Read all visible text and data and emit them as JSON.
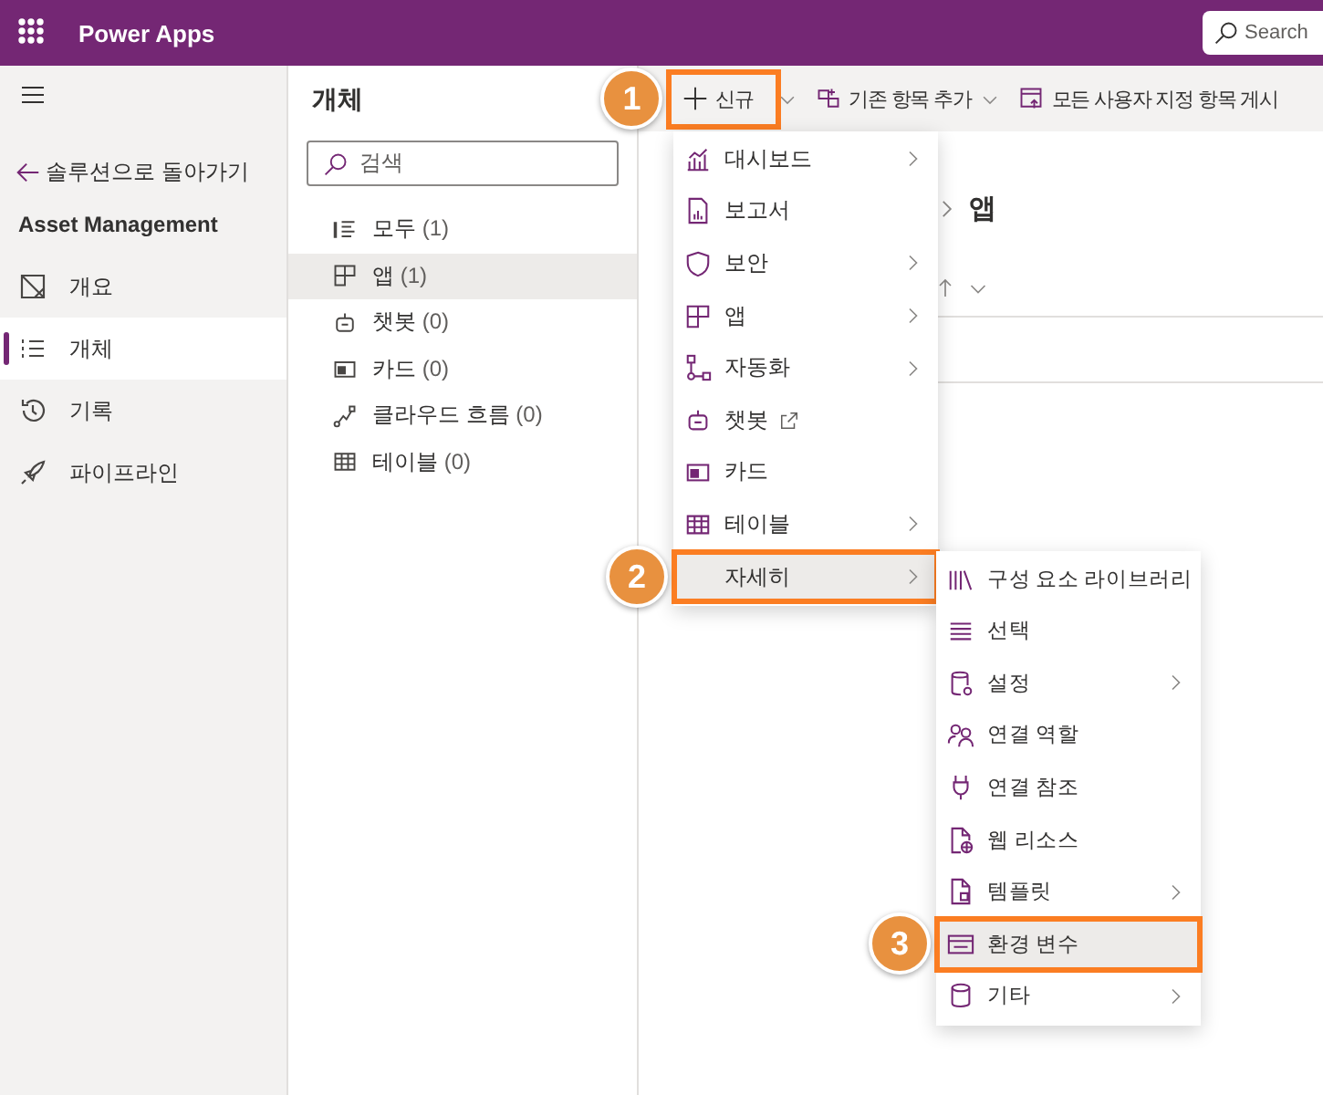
{
  "top_bar": {
    "app_title": "Power Apps",
    "search_placeholder": "Search"
  },
  "nav": {
    "back_link": "솔루션으로 돌아가기",
    "solution_title": "Asset Management",
    "items": [
      {
        "label": "개요",
        "selected": false
      },
      {
        "label": "개체",
        "selected": true
      },
      {
        "label": "기록",
        "selected": false
      },
      {
        "label": "파이프라인",
        "selected": false
      }
    ]
  },
  "objects_panel": {
    "title": "개체",
    "search_placeholder": "검색",
    "items": [
      {
        "label": "모두",
        "count": "(1)",
        "selected": false
      },
      {
        "label": "앱",
        "count": "(1)",
        "selected": true
      },
      {
        "label": "챗봇",
        "count": "(0)",
        "selected": false
      },
      {
        "label": "카드",
        "count": "(0)",
        "selected": false
      },
      {
        "label": "클라우드 흐름",
        "count": "(0)",
        "selected": false
      },
      {
        "label": "테이블",
        "count": "(0)",
        "selected": false
      }
    ]
  },
  "command_bar": {
    "items": [
      {
        "label": "신규",
        "dropdown": true,
        "callout": "1"
      },
      {
        "label": "기존 항목 추가",
        "dropdown": true
      },
      {
        "label": "모든 사용자 지정 항목 게시",
        "dropdown": false
      }
    ]
  },
  "breadcrumb": {
    "current": "앱"
  },
  "new_menu": {
    "items": [
      {
        "label": "대시보드",
        "submenu": true,
        "external": false,
        "selected": false
      },
      {
        "label": "보고서",
        "submenu": false,
        "external": false,
        "selected": false
      },
      {
        "label": "보안",
        "submenu": true,
        "external": false,
        "selected": false
      },
      {
        "label": "앱",
        "submenu": true,
        "external": false,
        "selected": false
      },
      {
        "label": "자동화",
        "submenu": true,
        "external": false,
        "selected": false
      },
      {
        "label": "챗봇",
        "submenu": false,
        "external": true,
        "selected": false
      },
      {
        "label": "카드",
        "submenu": false,
        "external": false,
        "selected": false
      },
      {
        "label": "테이블",
        "submenu": true,
        "external": false,
        "selected": false
      },
      {
        "label": "자세히",
        "submenu": true,
        "external": false,
        "selected": true,
        "callout": "2",
        "children": [
          {
            "label": "구성 요소 라이브러리",
            "submenu": false,
            "external": false,
            "selected": false
          },
          {
            "label": "선택",
            "submenu": false,
            "external": false,
            "selected": false
          },
          {
            "label": "설정",
            "submenu": true,
            "external": false,
            "selected": false
          },
          {
            "label": "연결 역할",
            "submenu": false,
            "external": false,
            "selected": false
          },
          {
            "label": "연결 참조",
            "submenu": false,
            "external": false,
            "selected": false
          },
          {
            "label": "웹 리소스",
            "submenu": false,
            "external": false,
            "selected": false
          },
          {
            "label": "템플릿",
            "submenu": true,
            "external": false,
            "selected": false
          },
          {
            "label": "환경 변수",
            "submenu": false,
            "external": false,
            "selected": true,
            "callout": "3"
          },
          {
            "label": "기타",
            "submenu": true,
            "external": false,
            "selected": false
          }
        ]
      }
    ]
  }
}
